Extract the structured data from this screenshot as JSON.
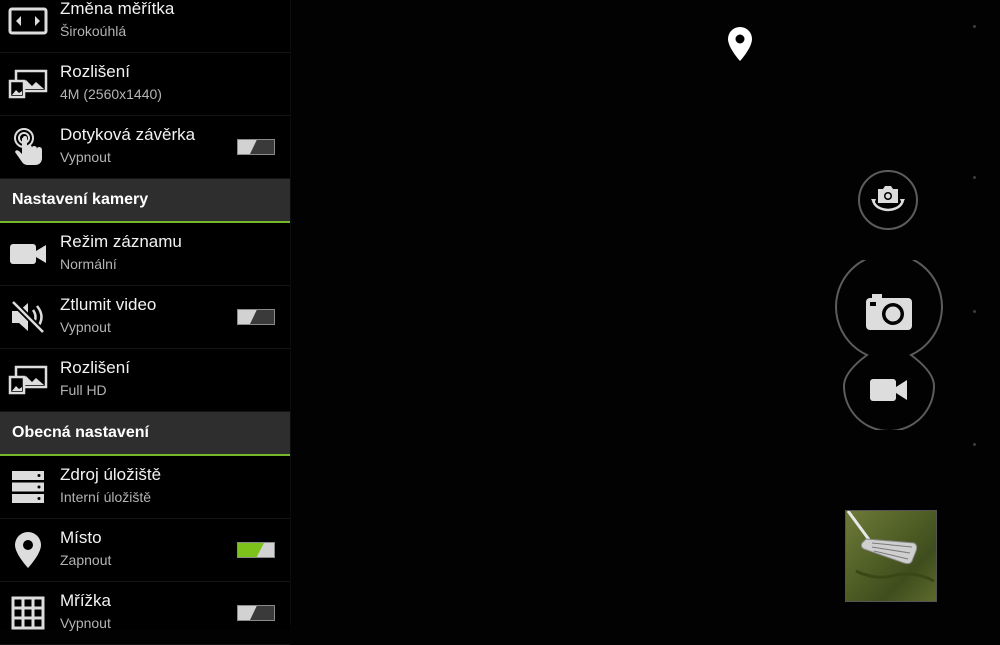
{
  "settings": {
    "top_rows": [
      {
        "icon": "aspect-ratio-icon",
        "title": "Změna měřítka",
        "sub": "Širokoúhlá"
      },
      {
        "icon": "image-resolution-icon",
        "title": "Rozlišení",
        "sub": "4M (2560x1440)"
      },
      {
        "icon": "touch-shutter-icon",
        "title": "Dotyková závěrka",
        "sub": "Vypnout",
        "toggle": "off"
      }
    ],
    "camera_header": "Nastavení kamery",
    "camera_rows": [
      {
        "icon": "video-camera-icon",
        "title": "Režim záznamu",
        "sub": "Normální"
      },
      {
        "icon": "mute-icon",
        "title": "Ztlumit video",
        "sub": "Vypnout",
        "toggle": "off"
      },
      {
        "icon": "image-resolution-icon",
        "title": "Rozlišení",
        "sub": "Full HD"
      }
    ],
    "general_header": "Obecná nastavení",
    "general_rows": [
      {
        "icon": "storage-icon",
        "title": "Zdroj úložiště",
        "sub": "Interní úložiště"
      },
      {
        "icon": "location-pin-icon",
        "title": "Místo",
        "sub": "Zapnout",
        "toggle": "on"
      },
      {
        "icon": "grid-icon",
        "title": "Mřížka",
        "sub": "Vypnout",
        "toggle": "off"
      }
    ]
  },
  "viewfinder": {
    "location_indicator": "location-pin-icon",
    "switch_camera": "switch-camera-icon",
    "shutter": "camera-icon",
    "record": "video-camera-icon",
    "thumbnail": "last-photo-thumbnail"
  },
  "colors": {
    "accent": "#77b829",
    "toggle_on": "#7cc21a",
    "header_bg": "#2e2e2e"
  }
}
